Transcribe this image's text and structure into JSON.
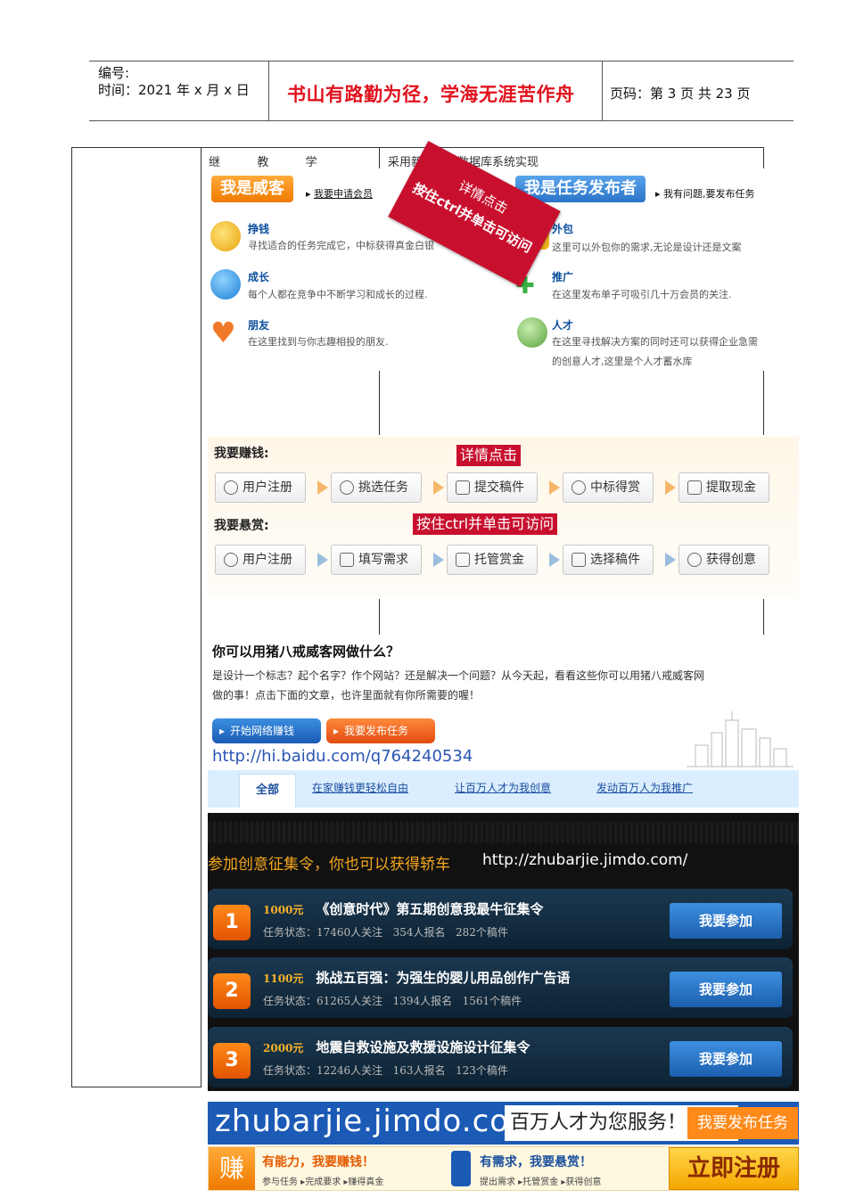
{
  "header": {
    "number_label": "编号:",
    "time_label": "时间：2021 年 x 月 x 日",
    "motto": "书山有路勤为径，学海无涯苦作舟",
    "page_info": "页码：第 3 页  共 23 页"
  },
  "table": {
    "col_heading_left": "继          教          学",
    "col_heading_right": "采用新闻发布数据库系统实现"
  },
  "section1": {
    "left_tag": "我是威客",
    "left_link": "我要申请会员",
    "right_tag": "我是任务发布者",
    "right_link": "我有问题,要发布任务",
    "stamp_line1": "详情点击",
    "stamp_line2": "按住ctrl并单击可访问",
    "left_features": [
      {
        "title": "挣钱",
        "desc": "寻找适合的任务完成它，中标获得真金白银"
      },
      {
        "title": "成长",
        "desc": "每个人都在竞争中不断学习和成长的过程."
      },
      {
        "title": "朋友",
        "desc": "在这里找到与你志趣相投的朋友."
      }
    ],
    "right_features": [
      {
        "title": "外包",
        "desc": "这里可以外包你的需求,无论是设计还是文案"
      },
      {
        "title": "推广",
        "desc": "在这里发布单子可吸引几十万会员的关注."
      },
      {
        "title": "人才",
        "desc": "在这里寻找解决方案的同时还可以获得企业急需",
        "desc2": "的创意人才,这里是个人才蓄水库"
      }
    ]
  },
  "section2": {
    "earn_label": "我要赚钱:",
    "reward_label": "我要悬赏:",
    "note1": "详情点击",
    "note2": "按住ctrl并单击可访问",
    "earn_steps": [
      "用户注册",
      "挑选任务",
      "提交稿件",
      "中标得赏",
      "提取现金"
    ],
    "reward_steps": [
      "用户注册",
      "填写需求",
      "托管赏金",
      "选择稿件",
      "获得创意"
    ]
  },
  "section3": {
    "question": "你可以用猪八戒威客网做什么？",
    "text_line1": "是设计一个标志？起个名字？作个网站？还是解决一个问题？从今天起，看看这些你可以用猪八戒威客网",
    "text_line2": "做的事！点击下面的文章，也许里面就有你所需要的喔！",
    "btn_earn": "开始网络赚钱",
    "btn_post": "我要发布任务",
    "url": "http://hi.baidu.com/q764240534",
    "tabs": [
      "全部",
      "在家赚钱更轻松自由",
      "让百万人才为我创意",
      "发动百万人为我推广"
    ]
  },
  "dark_panel": {
    "title": "参加创意征集令，你也可以获得轿车",
    "url": "http://zhubarjie.jimdo.com/",
    "items": [
      {
        "num": "1",
        "amount": "1000元",
        "title": "《创意时代》第五期创意我最牛征集令",
        "status": "任务状态：17460人关注   354人报名   282个稿件",
        "btn": "我要参加"
      },
      {
        "num": "2",
        "amount": "1100元",
        "title": "挑战五百强：为强生的婴儿用品创作广告语",
        "status": "任务状态：61265人关注   1394人报名   1561个稿件",
        "btn": "我要参加"
      },
      {
        "num": "3",
        "amount": "2000元",
        "title": "地震自救设施及救援设施设计征集令",
        "status": "任务状态：12246人关注   163人报名   123个稿件",
        "btn": "我要参加"
      }
    ]
  },
  "banner": {
    "domain": "zhubarjie.jimdo.com",
    "slogan": "百万人才为您服务！",
    "post_btn": "我要发布任务"
  },
  "strip": {
    "earn_char": "赚",
    "earn_title": "有能力，我要赚钱！",
    "earn_sub": "参与任务 ▸完成要求 ▸赚得真金",
    "need_title": "有需求，我要悬赏！",
    "need_sub": "提出需求 ▸托管赏金 ▸获得创意",
    "register": "立即注册"
  }
}
